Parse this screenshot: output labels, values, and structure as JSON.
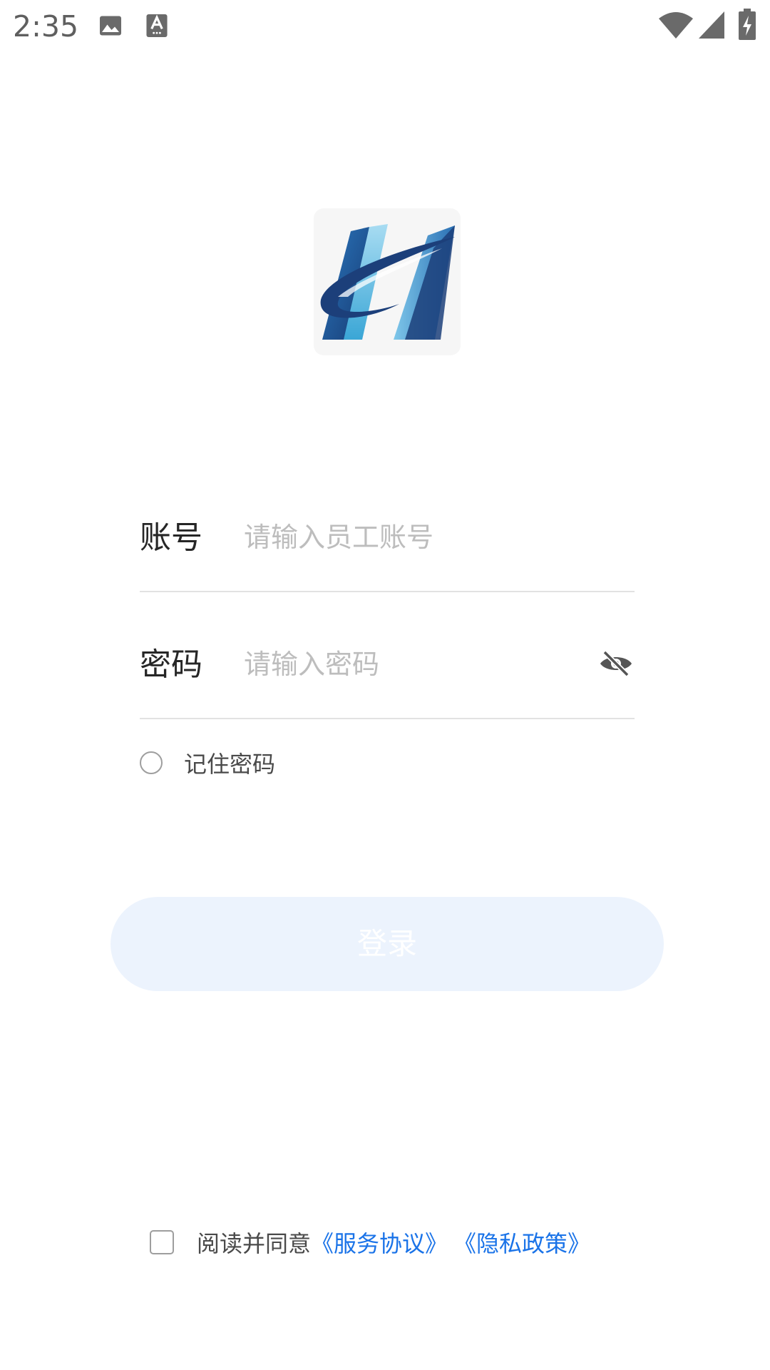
{
  "status_bar": {
    "time": "2:35",
    "icons": [
      "image-icon",
      "text-format-icon",
      "wifi-icon",
      "signal-icon",
      "battery-charging-icon"
    ]
  },
  "logo": {
    "icon": "company-logo-h",
    "colors": {
      "dark_blue": "#1c3f7a",
      "mid_blue": "#2a6fb3",
      "light_blue": "#7ac4e6",
      "background": "#f6f6f6"
    }
  },
  "form": {
    "account": {
      "label": "账号",
      "value": "",
      "placeholder": "请输入员工账号"
    },
    "password": {
      "label": "密码",
      "value": "",
      "placeholder": "请输入密码",
      "toggle_icon": "eye-off-icon"
    },
    "remember": {
      "label": "记住密码",
      "checked": false
    }
  },
  "login": {
    "label": "登录",
    "background": "#ecf3fd",
    "text_color": "#ffffff"
  },
  "agreement": {
    "prefix": "阅读并同意",
    "service_link": "《服务协议》",
    "privacy_link": "《隐私政策》",
    "checked": false,
    "link_color": "#1a73e8"
  }
}
